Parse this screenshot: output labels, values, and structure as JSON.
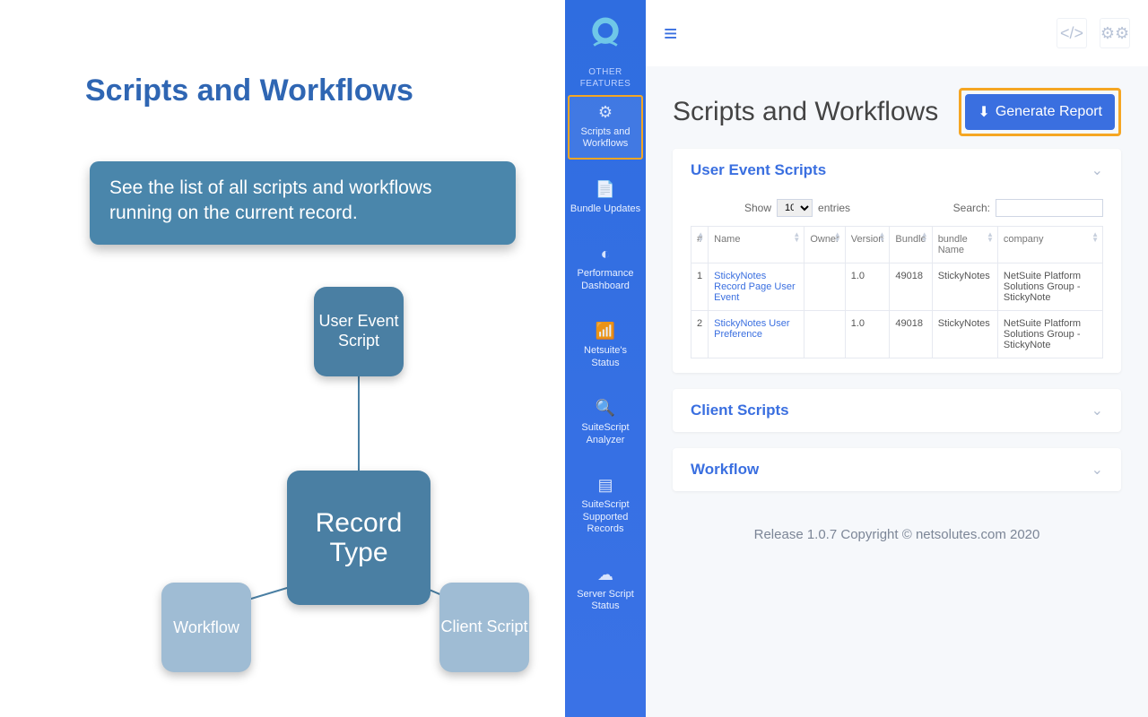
{
  "left": {
    "title": "Scripts and Workflows",
    "callout": "See the list of all scripts and workflows running on the current record.",
    "diagram": {
      "center": "Record Type",
      "top": "User Event Script",
      "bottom_left": "Workflow",
      "bottom_right": "Client Script"
    }
  },
  "sidebar": {
    "section_label": "OTHER FEATURES",
    "items": [
      {
        "icon": "⚙",
        "label": "Scripts and Workflows",
        "active": true
      },
      {
        "icon": "📄",
        "label": "Bundle Updates"
      },
      {
        "icon": "◐",
        "label": "Performance Dashboard"
      },
      {
        "icon": "📶",
        "label": "Netsuite's Status"
      },
      {
        "icon": "🔍",
        "label": "SuiteScript Analyzer"
      },
      {
        "icon": "▤",
        "label": "SuiteScript Supported Records"
      },
      {
        "icon": "☁",
        "label": "Server Script Status"
      }
    ]
  },
  "topbar": {
    "icon1": "code-icon",
    "icon2": "gears-icon"
  },
  "page": {
    "title": "Scripts and Workflows",
    "generate_label": "Generate Report"
  },
  "sections": {
    "user_event": {
      "title": "User Event Scripts",
      "show_label": "Show",
      "entries_label": "entries",
      "entries_value": "10",
      "search_label": "Search:",
      "columns": [
        "#",
        "Name",
        "Owner",
        "Version",
        "Bundle",
        "bundle Name",
        "company"
      ],
      "rows": [
        {
          "num": "1",
          "name": "StickyNotes Record Page User Event",
          "owner": "",
          "version": "1.0",
          "bundle": "49018",
          "bundle_name": "StickyNotes",
          "company": "NetSuite Platform Solutions Group - StickyNote"
        },
        {
          "num": "2",
          "name": "StickyNotes User Preference",
          "owner": "",
          "version": "1.0",
          "bundle": "49018",
          "bundle_name": "StickyNotes",
          "company": "NetSuite Platform Solutions Group - StickyNote"
        }
      ]
    },
    "client_scripts": {
      "title": "Client Scripts"
    },
    "workflow": {
      "title": "Workflow"
    }
  },
  "footer": "Release 1.0.7 Copyright © netsolutes.com 2020"
}
